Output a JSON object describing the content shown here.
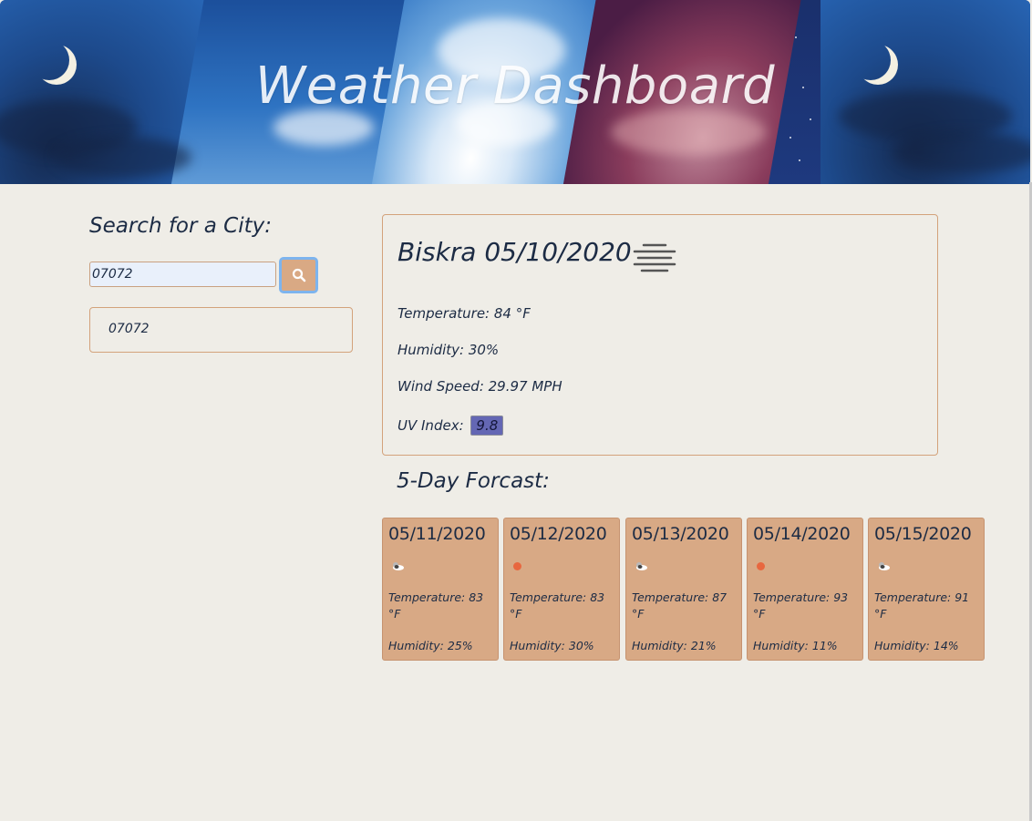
{
  "header": {
    "title": "Weather Dashboard"
  },
  "search": {
    "heading": "Search for a City:",
    "input_value": "07072",
    "button_icon": "search-icon",
    "history": [
      "07072"
    ]
  },
  "current": {
    "city_date": "Biskra 05/10/2020",
    "icon": "mist-icon",
    "temperature": "Temperature: 84 °F",
    "humidity": "Humidity: 30%",
    "wind_speed": "Wind Speed: 29.97 MPH",
    "uv_label": "UV Index:",
    "uv_value": "9.8",
    "uv_color": "#6467b4"
  },
  "forecast": {
    "heading": "5-Day Forcast:",
    "days": [
      {
        "date": "05/11/2020",
        "icon": "partly-cloudy-icon",
        "temperature": "Temperature: 83 °F",
        "humidity": "Humidity: 25%"
      },
      {
        "date": "05/12/2020",
        "icon": "sun-icon",
        "temperature": "Temperature: 83 °F",
        "humidity": "Humidity: 30%"
      },
      {
        "date": "05/13/2020",
        "icon": "partly-cloudy-icon",
        "temperature": "Temperature: 87 °F",
        "humidity": "Humidity: 21%"
      },
      {
        "date": "05/14/2020",
        "icon": "sun-icon",
        "temperature": "Temperature: 93 °F",
        "humidity": "Humidity: 11%"
      },
      {
        "date": "05/15/2020",
        "icon": "partly-cloudy-icon",
        "temperature": "Temperature: 91 °F",
        "humidity": "Humidity: 14%"
      }
    ]
  },
  "colors": {
    "background": "#efede7",
    "card_accent": "#d8a985",
    "text": "#1c2b44"
  }
}
